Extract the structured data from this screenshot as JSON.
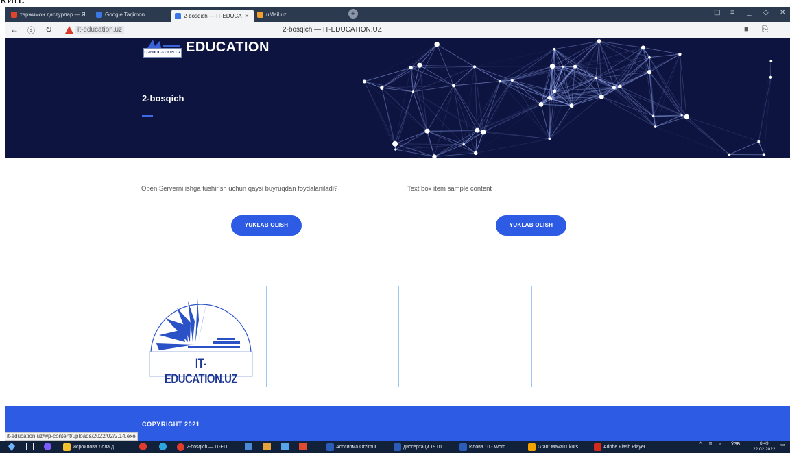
{
  "browser": {
    "tabs": [
      {
        "label": "таржимон дастурлар — Я",
        "color": "#e0452c"
      },
      {
        "label": "Google Tarjimon",
        "color": "#3b78e7"
      },
      {
        "label": "2-bosqich — IT-EDUCA",
        "color": "#3b78e7",
        "active": true
      },
      {
        "label": "uMail.uz",
        "color": "#f0a030"
      }
    ],
    "new_tab_symbol": "+",
    "address_url": "it-education.uz",
    "page_title": "2-bosqich — IT-EDUCATION.UZ"
  },
  "header": {
    "logo_text": "IT-EDUCATION.UZ",
    "brand": "EDUCATION",
    "page_heading": "2-bosqich"
  },
  "content": {
    "left_text": "Open Serverni ishga tushirish uchun qaysi buyruqdan foydalaniladi?",
    "right_text": "Text box item sample content",
    "left_button": "YUKLAB OLISH",
    "right_button": "YUKLAB OLISH",
    "logo_label": "IT-EDUCATION.UZ"
  },
  "footer": {
    "copyright": "COPYRIGHT 2021"
  },
  "status_bar": {
    "url": "it-education.uz/wp-content/uploads/2022/02/2.14.exe"
  },
  "taskbar": {
    "items": [
      {
        "label": "Исроилова Лола д...",
        "color": "#f2c12e"
      },
      {
        "label": "2-bosqich — IT-ED...",
        "color": "#e03c2e"
      },
      {
        "label": "Асосиома Orzimur...",
        "color": "#2b5cb8"
      },
      {
        "label": "диссертаци 19.01. ...",
        "color": "#2b5cb8"
      },
      {
        "label": "Илова 10 - Word",
        "color": "#2b5cb8"
      },
      {
        "label": "Grant Mavzu1 kurs...",
        "color": "#f2a300"
      },
      {
        "label": "Adobe Flash Player ...",
        "color": "#d42a1c"
      }
    ],
    "language": "ЎЗБ",
    "time": "8:49",
    "date": "22.02.2022"
  },
  "colors": {
    "hero_bg": "#0d1440",
    "accent": "#2d5be3"
  }
}
